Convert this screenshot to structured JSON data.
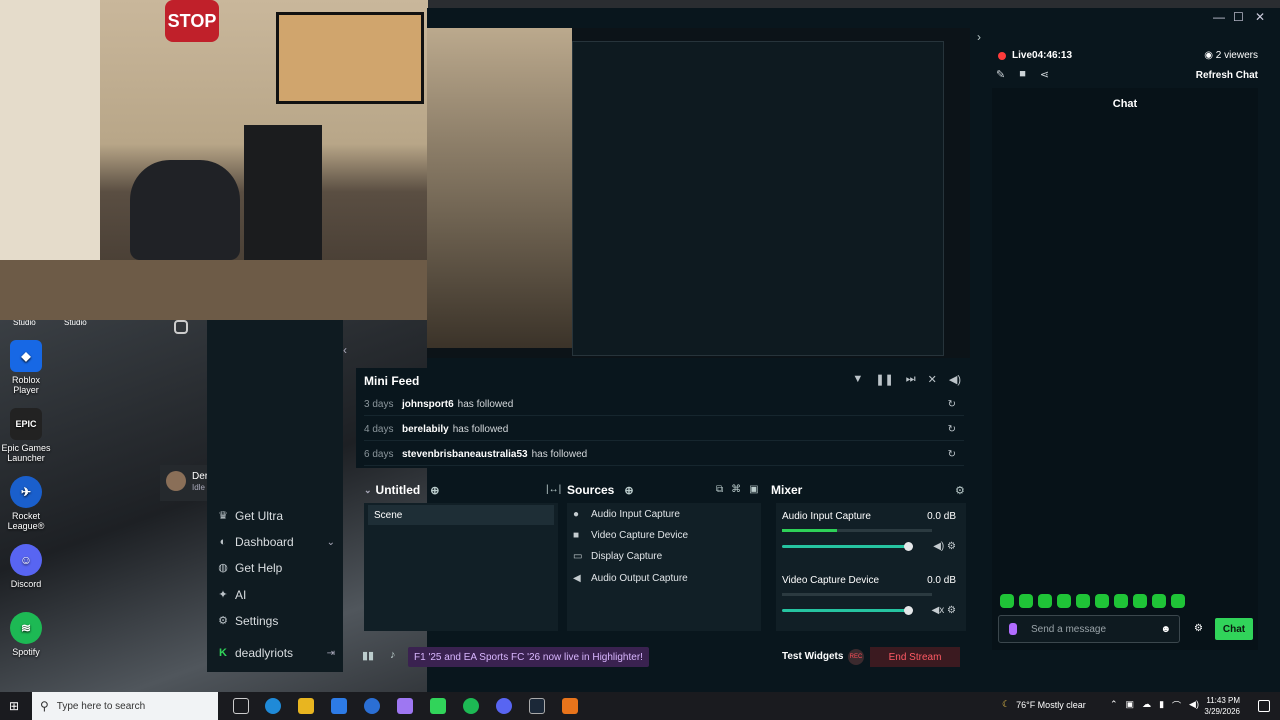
{
  "webcam": {
    "stop_text": "STOP"
  },
  "desktop": {
    "studio_labels": [
      "Studio",
      "Studio"
    ],
    "icons": [
      {
        "label": "Roblox Player",
        "icon": "roblox-icon",
        "color": "#1768e5"
      },
      {
        "label": "Epic Games Launcher",
        "icon": "epic-games-icon",
        "color": "#222222"
      },
      {
        "label": "Rocket League®",
        "icon": "rocket-league-icon",
        "color": "#1a5fcc"
      },
      {
        "label": "Discord",
        "icon": "discord-icon",
        "color": "#5865f2"
      },
      {
        "label": "Spotify",
        "icon": "spotify-icon",
        "color": "#1db954"
      }
    ],
    "epic_short": "EPIC",
    "user_card": {
      "name": "Der",
      "status": "Idle"
    }
  },
  "studio_nav": {
    "items": [
      {
        "label": "Get Ultra",
        "icon": "ultra-icon"
      },
      {
        "label": "Dashboard",
        "icon": "dashboard-icon"
      },
      {
        "label": "Get Help",
        "icon": "help-icon"
      },
      {
        "label": "AI",
        "icon": "ai-icon"
      },
      {
        "label": "Settings",
        "icon": "settings-icon"
      },
      {
        "label": "deadlyriots",
        "icon": "kick-icon"
      }
    ]
  },
  "minifeed": {
    "title": "Mini Feed",
    "rows": [
      {
        "age": "3 days",
        "user": "johnsport6",
        "action": "has followed"
      },
      {
        "age": "4 days",
        "user": "berelabily",
        "action": "has followed"
      },
      {
        "age": "6 days",
        "user": "stevenbrisbaneaustralia53",
        "action": "has followed"
      }
    ]
  },
  "scenes": {
    "title": "Untitled",
    "items": [
      "Scene"
    ]
  },
  "sources": {
    "title": "Sources",
    "items": [
      {
        "label": "Audio Input Capture",
        "icon": "microphone-icon"
      },
      {
        "label": "Video Capture Device",
        "icon": "camera-icon"
      },
      {
        "label": "Display Capture",
        "icon": "monitor-icon"
      },
      {
        "label": "Audio Output Capture",
        "icon": "speaker-icon"
      }
    ]
  },
  "mixer": {
    "title": "Mixer",
    "channels": [
      {
        "name": "Audio Input Capture",
        "db": "0.0 dB",
        "level": 0.8
      },
      {
        "name": "Video Capture Device",
        "db": "0.0 dB",
        "level": 0.8
      }
    ]
  },
  "bottombar": {
    "promo": "F1 '25 and EA Sports FC '26 now live in Highlighter!",
    "test_widgets": "Test Widgets",
    "rec": "REC",
    "end_stream": "End Stream"
  },
  "chat": {
    "live": "Live",
    "live_time": "04:46:13",
    "viewers": "2 viewers",
    "refresh": "Refresh Chat",
    "title": "Chat",
    "placeholder": "Send a message",
    "send": "Chat"
  },
  "taskbar": {
    "search_placeholder": "Type here to search",
    "weather": "76°F  Mostly clear",
    "time": "11:43 PM",
    "date": "3/29/2026"
  },
  "colors": {
    "accent_green": "#31d45a",
    "live_red": "#ff3b3b",
    "end_stream_red": "#ff5a64"
  }
}
